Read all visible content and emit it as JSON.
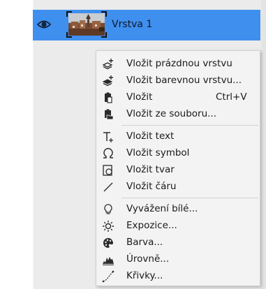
{
  "layer": {
    "name": "Vrstva 1",
    "icon": "eye-icon"
  },
  "colors": {
    "selection": "#3f8fef",
    "menu_background": "#f3f3f3",
    "panel_background": "#ebebeb"
  },
  "context_menu": {
    "insert_empty_layer": "Vložit prázdnou vrstvu",
    "insert_color_layer": "Vložit barevnou vrstvu...",
    "paste": "Vložit",
    "paste_shortcut": "Ctrl+V",
    "insert_from_file": "Vložit ze souboru...",
    "insert_text": "Vložit text",
    "insert_symbol": "Vložit symbol",
    "insert_shape": "Vložit tvar",
    "insert_line": "Vložit čáru",
    "white_balance": "Vyvážení bílé...",
    "exposure": "Expozice...",
    "color": "Barva...",
    "levels": "Úrovně...",
    "curves": "Křivky..."
  }
}
